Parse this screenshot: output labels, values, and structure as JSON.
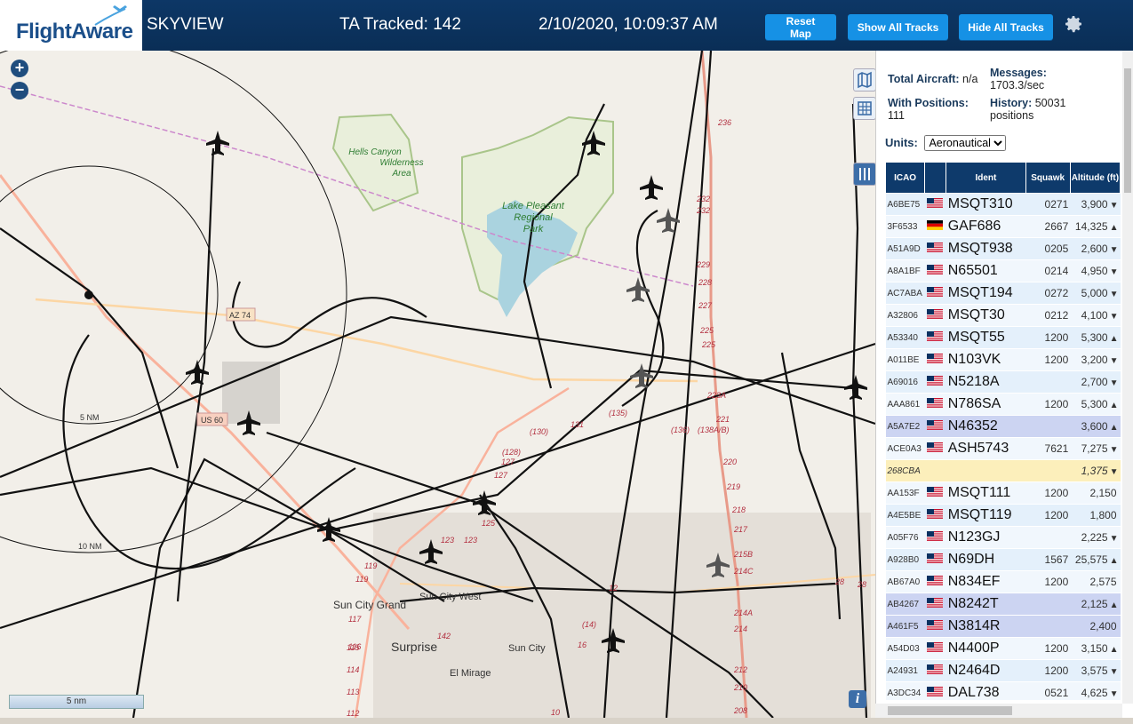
{
  "header": {
    "logo_text": "FlightAware",
    "site_name": "SKYVIEW",
    "ta_tracked": "TA Tracked: 142",
    "clock": "2/10/2020, 10:09:37 AM",
    "reset_map": "Reset Map",
    "show_all_tracks": "Show All Tracks",
    "hide_all_tracks": "Hide All Tracks",
    "settings_icon": "gear-icon"
  },
  "map": {
    "zoom_in": "+",
    "zoom_out": "−",
    "scale_label": "5 nm",
    "info": "i",
    "range_rings": [
      "5 NM",
      "10 NM"
    ],
    "labels": {
      "hells_canyon": [
        "Hells Canyon",
        "Wilderness",
        "Area"
      ],
      "lake_pleasant": [
        "Lake Pleasant",
        "Regional",
        "Park"
      ],
      "sun_city_grand": "Sun City Grand",
      "sun_city_west": "Sun City West",
      "surprise": "Surprise",
      "sun_city": "Sun City",
      "el_mirage": "El Mirage",
      "az74": "AZ 74",
      "us60": "US 60"
    },
    "road_numbers": [
      "236",
      "232",
      "232",
      "229",
      "228",
      "227",
      "225",
      "225",
      "223A",
      "221",
      "220",
      "219",
      "218",
      "217",
      "215B",
      "214C",
      "214A",
      "214",
      "212",
      "210",
      "208",
      "(135)",
      "(136)",
      "(138A/B)",
      "(130)",
      "131",
      "(128)",
      "127",
      "127",
      "125",
      "123",
      "123",
      "119",
      "119",
      "117",
      "116",
      "115",
      "114",
      "113",
      "112",
      "142",
      "(14)",
      "16",
      "12",
      "28",
      "28",
      "10"
    ],
    "colors": {
      "background": "#f2efe9",
      "lake": "#aad3df",
      "park": "#c8d7ab",
      "track": "#111111",
      "motorway": "#e89a89",
      "trunk": "#f9b29c",
      "primary": "#fcd6a4"
    }
  },
  "sidebar": {
    "total_aircraft_label": "Total Aircraft:",
    "total_aircraft_value": "n/a",
    "messages_label": "Messages:",
    "messages_value": "1703.3/sec",
    "with_positions_label": "With Positions:",
    "with_positions_value": "111",
    "history_label": "History:",
    "history_value": "50031",
    "history_unit": "positions",
    "units_label": "Units:",
    "units_value": "Aeronautical",
    "columns": [
      "ICAO",
      "",
      "Ident",
      "Squawk",
      "Altitude (ft)"
    ],
    "rows": [
      {
        "icao": "A6BE75",
        "flag": "us",
        "ident": "MSQT310",
        "squawk": "0271",
        "alt": "3,900",
        "dir": "▼",
        "style": "row-a"
      },
      {
        "icao": "3F6533",
        "flag": "de",
        "ident": "GAF686",
        "squawk": "2667",
        "alt": "14,325",
        "dir": "▲",
        "style": "row-b"
      },
      {
        "icao": "A51A9D",
        "flag": "us",
        "ident": "MSQT938",
        "squawk": "0205",
        "alt": "2,600",
        "dir": "▼",
        "style": "row-a"
      },
      {
        "icao": "A8A1BF",
        "flag": "us",
        "ident": "N65501",
        "squawk": "0214",
        "alt": "4,950",
        "dir": "▼",
        "style": "row-b"
      },
      {
        "icao": "AC7ABA",
        "flag": "us",
        "ident": "MSQT194",
        "squawk": "0272",
        "alt": "5,000",
        "dir": "▼",
        "style": "row-a"
      },
      {
        "icao": "A32806",
        "flag": "us",
        "ident": "MSQT30",
        "squawk": "0212",
        "alt": "4,100",
        "dir": "▼",
        "style": "row-b"
      },
      {
        "icao": "A53340",
        "flag": "us",
        "ident": "MSQT55",
        "squawk": "1200",
        "alt": "5,300",
        "dir": "▲",
        "style": "row-a"
      },
      {
        "icao": "A011BE",
        "flag": "us",
        "ident": "N103VK",
        "squawk": "1200",
        "alt": "3,200",
        "dir": "▼",
        "style": "row-b"
      },
      {
        "icao": "A69016",
        "flag": "us",
        "ident": "N5218A",
        "squawk": "",
        "alt": "2,700",
        "dir": "▼",
        "style": "row-a"
      },
      {
        "icao": "AAA861",
        "flag": "us",
        "ident": "N786SA",
        "squawk": "1200",
        "alt": "5,300",
        "dir": "▲",
        "style": "row-b"
      },
      {
        "icao": "A5A7E2",
        "flag": "us",
        "ident": "N46352",
        "squawk": "",
        "alt": "3,600",
        "dir": "▲",
        "style": "row-sel"
      },
      {
        "icao": "ACE0A3",
        "flag": "us",
        "ident": "ASH5743",
        "squawk": "7621",
        "alt": "7,275",
        "dir": "▼",
        "style": "row-b"
      },
      {
        "icao": "268CBA",
        "flag": "",
        "ident": "",
        "squawk": "",
        "alt": "1,375",
        "dir": "▼",
        "style": "row-hl"
      },
      {
        "icao": "AA153F",
        "flag": "us",
        "ident": "MSQT111",
        "squawk": "1200",
        "alt": "2,150",
        "dir": "",
        "style": "row-b"
      },
      {
        "icao": "A4E5BE",
        "flag": "us",
        "ident": "MSQT119",
        "squawk": "1200",
        "alt": "1,800",
        "dir": "",
        "style": "row-a"
      },
      {
        "icao": "A05F76",
        "flag": "us",
        "ident": "N123GJ",
        "squawk": "",
        "alt": "2,225",
        "dir": "▼",
        "style": "row-b"
      },
      {
        "icao": "A928B0",
        "flag": "us",
        "ident": "N69DH",
        "squawk": "1567",
        "alt": "25,575",
        "dir": "▲",
        "style": "row-a"
      },
      {
        "icao": "AB67A0",
        "flag": "us",
        "ident": "N834EF",
        "squawk": "1200",
        "alt": "2,575",
        "dir": "",
        "style": "row-b"
      },
      {
        "icao": "AB4267",
        "flag": "us",
        "ident": "N8242T",
        "squawk": "",
        "alt": "2,125",
        "dir": "▲",
        "style": "row-sel"
      },
      {
        "icao": "A461F5",
        "flag": "us",
        "ident": "N3814R",
        "squawk": "",
        "alt": "2,400",
        "dir": "",
        "style": "row-sel"
      },
      {
        "icao": "A54D03",
        "flag": "us",
        "ident": "N4400P",
        "squawk": "1200",
        "alt": "3,150",
        "dir": "▲",
        "style": "row-b"
      },
      {
        "icao": "A24931",
        "flag": "us",
        "ident": "N2464D",
        "squawk": "1200",
        "alt": "3,575",
        "dir": "▼",
        "style": "row-a"
      },
      {
        "icao": "A3DC34",
        "flag": "us",
        "ident": "DAL738",
        "squawk": "0521",
        "alt": "4,625",
        "dir": "▼",
        "style": "row-b"
      }
    ]
  }
}
